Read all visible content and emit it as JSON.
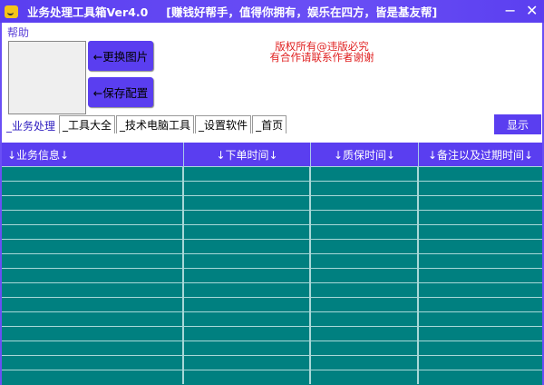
{
  "window": {
    "title": "业务处理工具箱Ver4.0",
    "slogan": "[赚钱好帮手，值得你拥有，娱乐在四方，皆是基友帮]",
    "minimize": "−",
    "close": "✕"
  },
  "menu": {
    "help": "帮助"
  },
  "buttons": {
    "change_image": "←更换图片",
    "save_config": "←保存配置",
    "show": "显示"
  },
  "notice": {
    "line1": "版权所有@违版必究",
    "line2": "有合作请联系作者谢谢"
  },
  "tabs": [
    {
      "label": "_业务处理"
    },
    {
      "label": "_工具大全"
    },
    {
      "label": "_技术电脑工具"
    },
    {
      "label": "_设置软件"
    },
    {
      "label": "_首页"
    }
  ],
  "table": {
    "columns": [
      "↓业务信息↓",
      "↓下单时间↓",
      "↓质保时间↓",
      "↓备注以及过期时间↓"
    ],
    "row_count": 15
  },
  "colors": {
    "accent": "#5a3ef0",
    "grid": "#008080",
    "notice": "#e02020"
  }
}
